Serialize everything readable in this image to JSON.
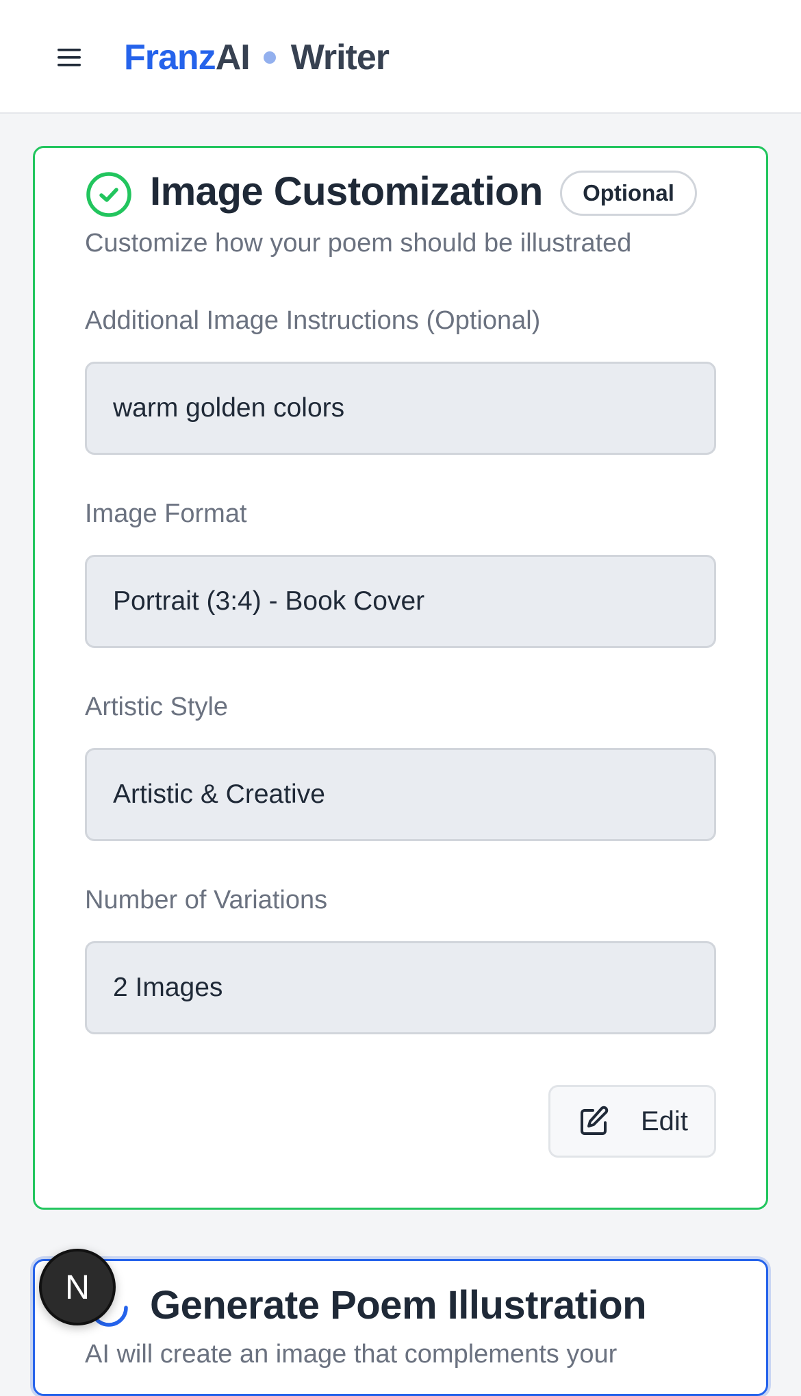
{
  "header": {
    "brand_franz": "Franz",
    "brand_ai": "AI",
    "brand_writer": "Writer"
  },
  "customize": {
    "title": "Image Customization",
    "badge": "Optional",
    "subtitle": "Customize how your poem should be illustrated",
    "fields": [
      {
        "label": "Additional Image Instructions (Optional)",
        "value": "warm golden colors"
      },
      {
        "label": "Image Format",
        "value": "Portrait (3:4) - Book Cover"
      },
      {
        "label": "Artistic Style",
        "value": "Artistic & Creative"
      },
      {
        "label": "Number of Variations",
        "value": "2 Images"
      }
    ],
    "edit_label": "Edit"
  },
  "generate": {
    "title": "Generate Poem Illustration",
    "subtitle": "AI will create an image that complements your"
  },
  "fab": {
    "letter": "N"
  },
  "colors": {
    "accent_blue": "#2563eb",
    "success_green": "#22c55e",
    "text_dark": "#1f2937",
    "text_muted": "#6b7280"
  }
}
